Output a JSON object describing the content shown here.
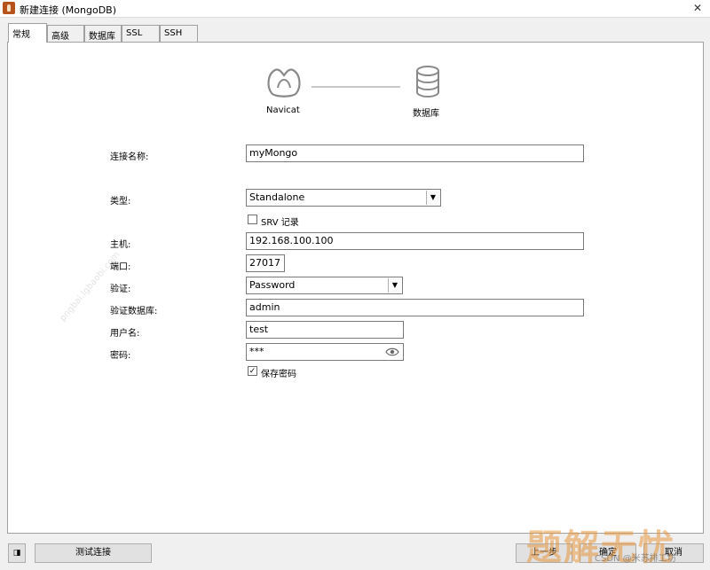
{
  "window": {
    "title": "新建连接 (MongoDB)",
    "close_glyph": "✕"
  },
  "tabs": [
    "常规",
    "高级",
    "数据库",
    "SSL",
    "SSH"
  ],
  "graphic": {
    "left_label": "Navicat",
    "right_label": "数据库"
  },
  "form": {
    "connection_name": {
      "label": "连接名称:",
      "value": "myMongo"
    },
    "type": {
      "label": "类型:",
      "value": "Standalone"
    },
    "srv": {
      "label": "SRV 记录",
      "checked": false
    },
    "host": {
      "label": "主机:",
      "value": "192.168.100.100"
    },
    "port": {
      "label": "端口:",
      "value": "27017"
    },
    "auth": {
      "label": "验证:",
      "value": "Password"
    },
    "auth_db": {
      "label": "验证数据库:",
      "value": "admin"
    },
    "username": {
      "label": "用户名:",
      "value": "test"
    },
    "password": {
      "label": "密码:",
      "value": "***"
    },
    "save_password": {
      "label": "保存密码",
      "checked": true,
      "mark": "✓"
    }
  },
  "footer": {
    "test_button": "测试连接",
    "back_button": "上一步",
    "ok_button": "确定",
    "cancel_button": "取消"
  },
  "watermarks": {
    "diagonal": "pngbai.lgbaobi.com",
    "brand": "题解无忧",
    "csdn": "CSDN @米苏排工坊"
  },
  "colors": {
    "panel_bg": "#ffffff",
    "window_bg": "#f0f0f0",
    "icon_gray": "#8a8a8a",
    "connector_line": "#c8c8c8"
  }
}
